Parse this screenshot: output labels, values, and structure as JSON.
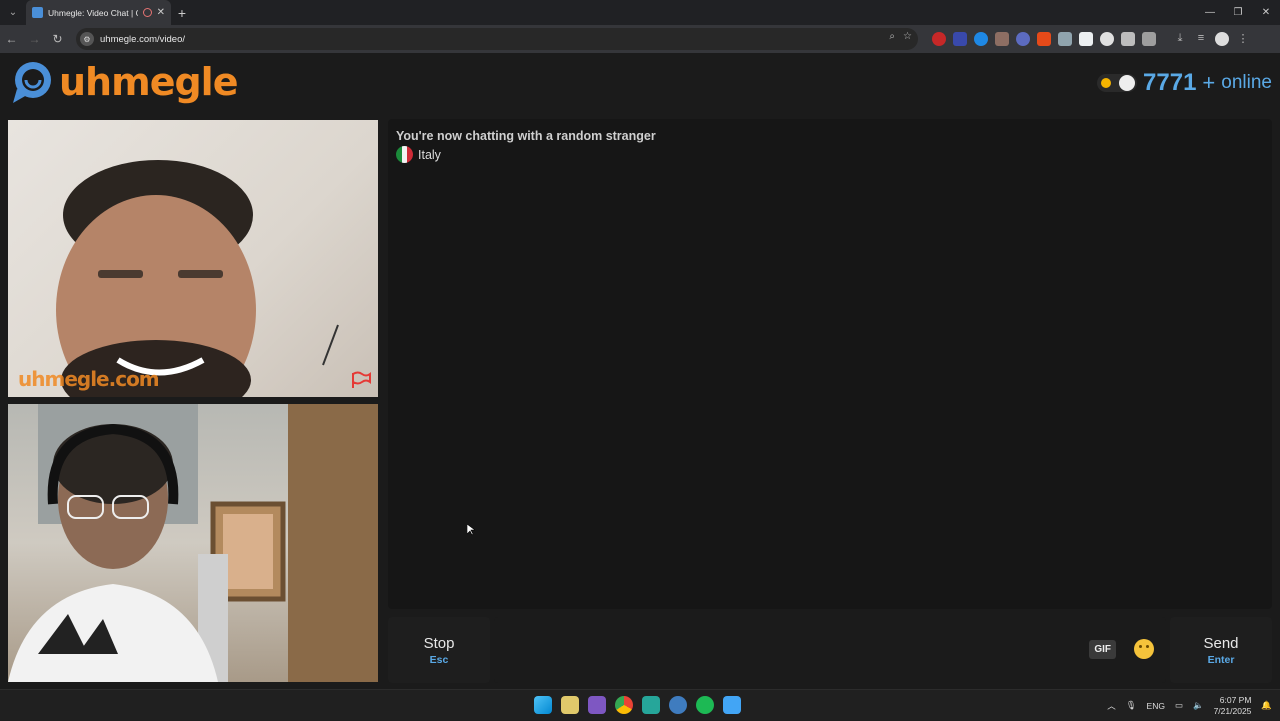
{
  "browser": {
    "tab_title": "Uhmegle: Video Chat | Ome",
    "url": "uhmegle.com/video/"
  },
  "site": {
    "logo_text": "uhmegle",
    "online_count": "7771",
    "online_plus": "+",
    "online_label": "online",
    "cam_watermark": "uhmegle.com"
  },
  "chat": {
    "status": "You're now chatting with a random stranger",
    "country": "Italy"
  },
  "controls": {
    "stop_label": "Stop",
    "stop_key": "Esc",
    "send_label": "Send",
    "send_key": "Enter",
    "gif_label": "GIF"
  },
  "taskbar": {
    "lang": "ENG",
    "time": "6:07 PM",
    "date": "7/21/2025"
  },
  "colors": {
    "brand_orange": "#f08a24",
    "accent_blue": "#5aa9e6"
  }
}
